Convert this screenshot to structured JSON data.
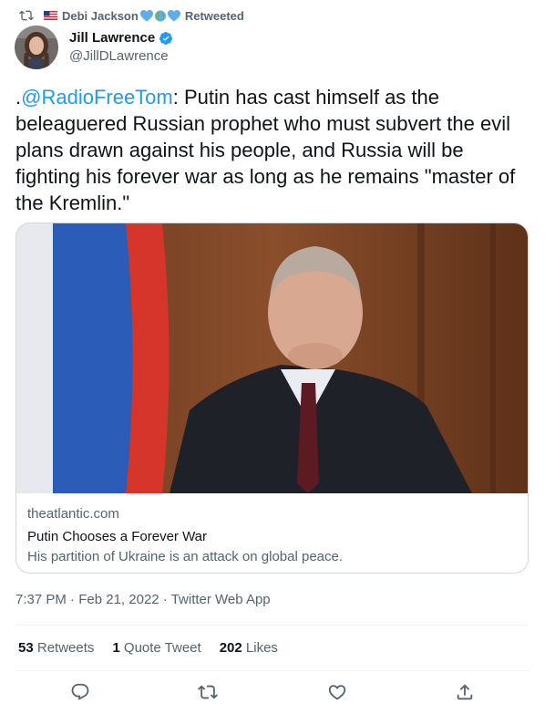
{
  "retweet": {
    "retweeter": "Debi Jackson",
    "label": "Retweeted",
    "icon": "retweet-icon"
  },
  "author": {
    "name": "Jill Lawrence",
    "handle": "@JillDLawrence",
    "verified": true
  },
  "tweet": {
    "prefix": ".",
    "mention": "@RadioFreeTom",
    "body": ": Putin has cast himself as the beleaguered Russian prophet who must subvert the evil plans drawn against his people, and Russia will be fighting his forever war as long as he remains \"master of the Kremlin.\""
  },
  "card": {
    "domain": "theatlantic.com",
    "title": "Putin Chooses a Forever War",
    "description": "His partition of Ukraine is an attack on global peace."
  },
  "meta": {
    "time": "7:37 PM",
    "date": "Feb 21, 2022",
    "separator": "·",
    "source": "Twitter Web App"
  },
  "stats": {
    "retweets_count": "53",
    "retweets_label": "Retweets",
    "quotes_count": "1",
    "quotes_label": "Quote Tweet",
    "likes_count": "202",
    "likes_label": "Likes"
  },
  "colors": {
    "accent": "#1d9bf0",
    "muted_text": "#536471",
    "border": "#cfd9de"
  }
}
